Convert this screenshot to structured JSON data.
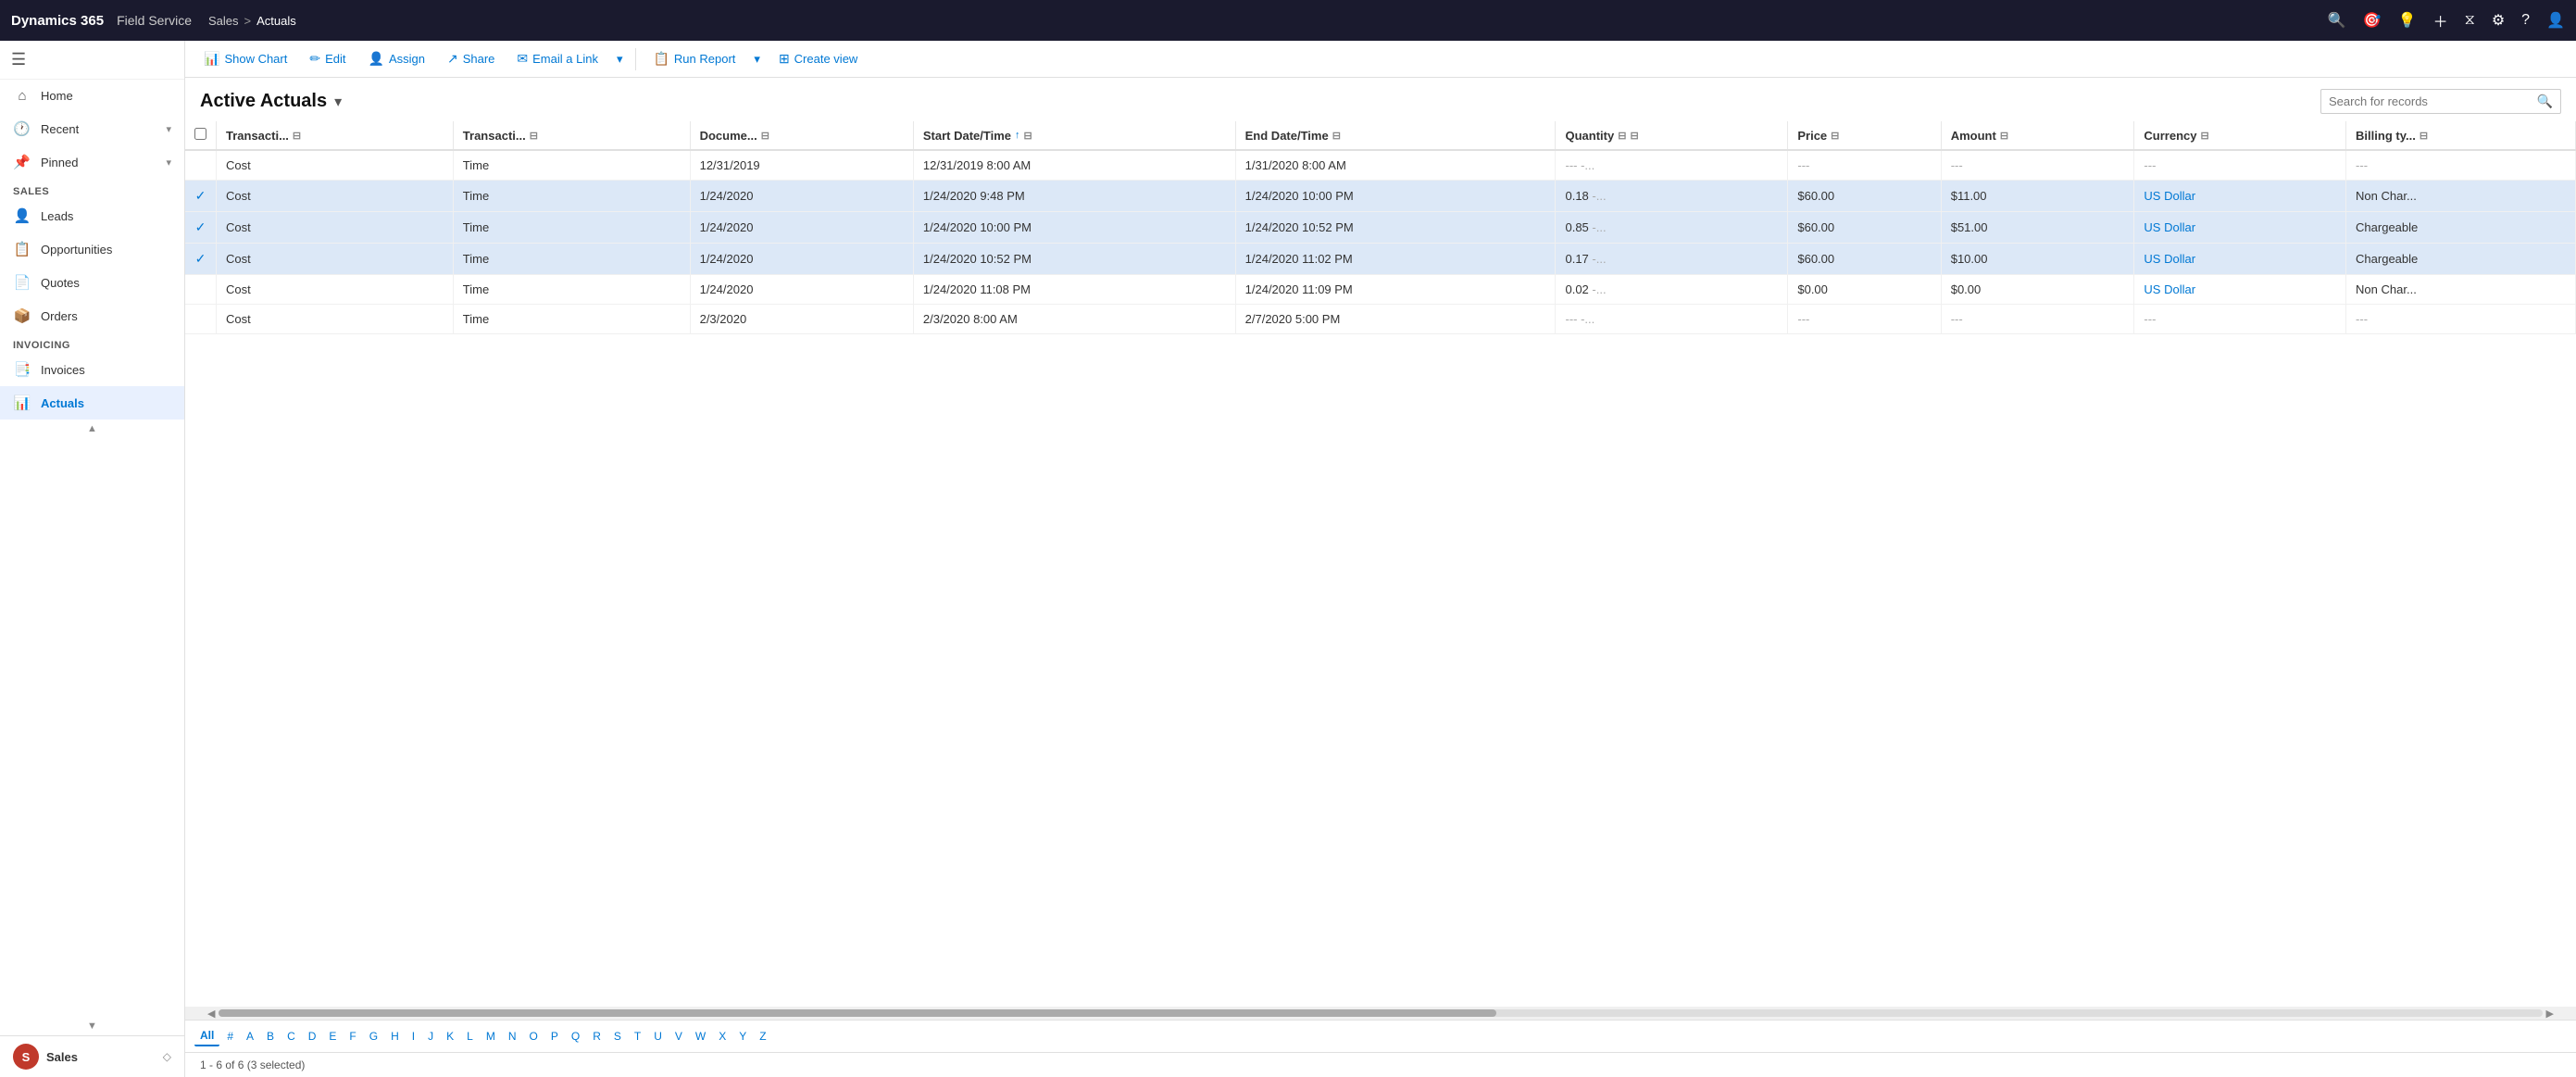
{
  "topnav": {
    "app": "Dynamics 365",
    "module": "Field Service",
    "breadcrumb": {
      "parent": "Sales",
      "separator": ">",
      "current": "Actuals"
    },
    "icons": [
      "search",
      "target",
      "bulb",
      "plus",
      "filter",
      "settings",
      "help",
      "user"
    ]
  },
  "sidebar": {
    "toggle_icon": "☰",
    "nav_items": [
      {
        "id": "home",
        "label": "Home",
        "icon": "⌂",
        "expandable": false
      },
      {
        "id": "recent",
        "label": "Recent",
        "icon": "🕐",
        "expandable": true
      },
      {
        "id": "pinned",
        "label": "Pinned",
        "icon": "📌",
        "expandable": true
      }
    ],
    "sections": [
      {
        "title": "Sales",
        "items": [
          {
            "id": "leads",
            "label": "Leads",
            "icon": "👤",
            "active": false
          },
          {
            "id": "opportunities",
            "label": "Opportunities",
            "icon": "📋",
            "active": false
          },
          {
            "id": "quotes",
            "label": "Quotes",
            "icon": "📄",
            "active": false
          },
          {
            "id": "orders",
            "label": "Orders",
            "icon": "📦",
            "active": false
          }
        ]
      },
      {
        "title": "Invoicing",
        "items": [
          {
            "id": "invoices",
            "label": "Invoices",
            "icon": "📑",
            "active": false
          },
          {
            "id": "actuals",
            "label": "Actuals",
            "icon": "📊",
            "active": true
          }
        ]
      }
    ],
    "bottom": {
      "avatar_initials": "S",
      "label": "Sales"
    }
  },
  "toolbar": {
    "show_chart": "Show Chart",
    "edit": "Edit",
    "assign": "Assign",
    "share": "Share",
    "email_a_link": "Email a Link",
    "run_report": "Run Report",
    "create_view": "Create view"
  },
  "page": {
    "title": "Active Actuals",
    "search_placeholder": "Search for records"
  },
  "table": {
    "columns": [
      {
        "id": "check",
        "label": ""
      },
      {
        "id": "transaction_type",
        "label": "Transacti...",
        "filter": true
      },
      {
        "id": "transaction_category",
        "label": "Transacti...",
        "filter": true
      },
      {
        "id": "document",
        "label": "Docume...",
        "filter": true
      },
      {
        "id": "start_date",
        "label": "Start Date/Time",
        "filter": true,
        "sort": true
      },
      {
        "id": "end_date",
        "label": "End Date/Time",
        "filter": true
      },
      {
        "id": "quantity",
        "label": "Quantity",
        "filter": true
      },
      {
        "id": "price",
        "label": "Price",
        "filter": true
      },
      {
        "id": "amount",
        "label": "Amount",
        "filter": true
      },
      {
        "id": "currency",
        "label": "Currency",
        "filter": true
      },
      {
        "id": "billing_type",
        "label": "Billing ty...",
        "filter": true
      }
    ],
    "rows": [
      {
        "selected": false,
        "check": "",
        "transaction_type": "Cost",
        "transaction_category": "Time",
        "document": "12/31/2019",
        "start_date": "12/31/2019 8:00 AM",
        "end_date": "1/31/2020 8:00 AM",
        "quantity": "---",
        "price_col1": "-...",
        "price_col2": "-..",
        "price": "---",
        "amount": "---",
        "currency": "---",
        "billing_type": "---"
      },
      {
        "selected": true,
        "check": "✓",
        "transaction_type": "Cost",
        "transaction_category": "Time",
        "document": "1/24/2020",
        "start_date": "1/24/2020 9:48 PM",
        "end_date": "1/24/2020 10:00 PM",
        "quantity": "0.18",
        "price_col1": "-...",
        "price_col2": "-..",
        "price": "$60.00",
        "amount": "$11.00",
        "currency": "US Dollar",
        "billing_type": "Non Char..."
      },
      {
        "selected": true,
        "check": "✓",
        "transaction_type": "Cost",
        "transaction_category": "Time",
        "document": "1/24/2020",
        "start_date": "1/24/2020 10:00 PM",
        "end_date": "1/24/2020 10:52 PM",
        "quantity": "0.85",
        "price_col1": "-...",
        "price_col2": "-..",
        "price": "$60.00",
        "amount": "$51.00",
        "currency": "US Dollar",
        "billing_type": "Chargeable"
      },
      {
        "selected": true,
        "check": "✓",
        "transaction_type": "Cost",
        "transaction_category": "Time",
        "document": "1/24/2020",
        "start_date": "1/24/2020 10:52 PM",
        "end_date": "1/24/2020 11:02 PM",
        "quantity": "0.17",
        "price_col1": "-...",
        "price_col2": "-..",
        "price": "$60.00",
        "amount": "$10.00",
        "currency": "US Dollar",
        "billing_type": "Chargeable"
      },
      {
        "selected": false,
        "check": "",
        "transaction_type": "Cost",
        "transaction_category": "Time",
        "document": "1/24/2020",
        "start_date": "1/24/2020 11:08 PM",
        "end_date": "1/24/2020 11:09 PM",
        "quantity": "0.02",
        "price_col1": "-...",
        "price_col2": "-..",
        "price": "$0.00",
        "amount": "$0.00",
        "currency": "US Dollar",
        "billing_type": "Non Char..."
      },
      {
        "selected": false,
        "check": "",
        "transaction_type": "Cost",
        "transaction_category": "Time",
        "document": "2/3/2020",
        "start_date": "2/3/2020 8:00 AM",
        "end_date": "2/7/2020 5:00 PM",
        "quantity": "---",
        "price_col1": "-...",
        "price_col2": "-..",
        "price": "---",
        "amount": "---",
        "currency": "---",
        "billing_type": "---"
      }
    ]
  },
  "alpha_bar": {
    "active": "All",
    "chars": [
      "All",
      "#",
      "A",
      "B",
      "C",
      "D",
      "E",
      "F",
      "G",
      "H",
      "I",
      "J",
      "K",
      "L",
      "M",
      "N",
      "O",
      "P",
      "Q",
      "R",
      "S",
      "T",
      "U",
      "V",
      "W",
      "X",
      "Y",
      "Z"
    ]
  },
  "status": "1 - 6 of 6 (3 selected)"
}
